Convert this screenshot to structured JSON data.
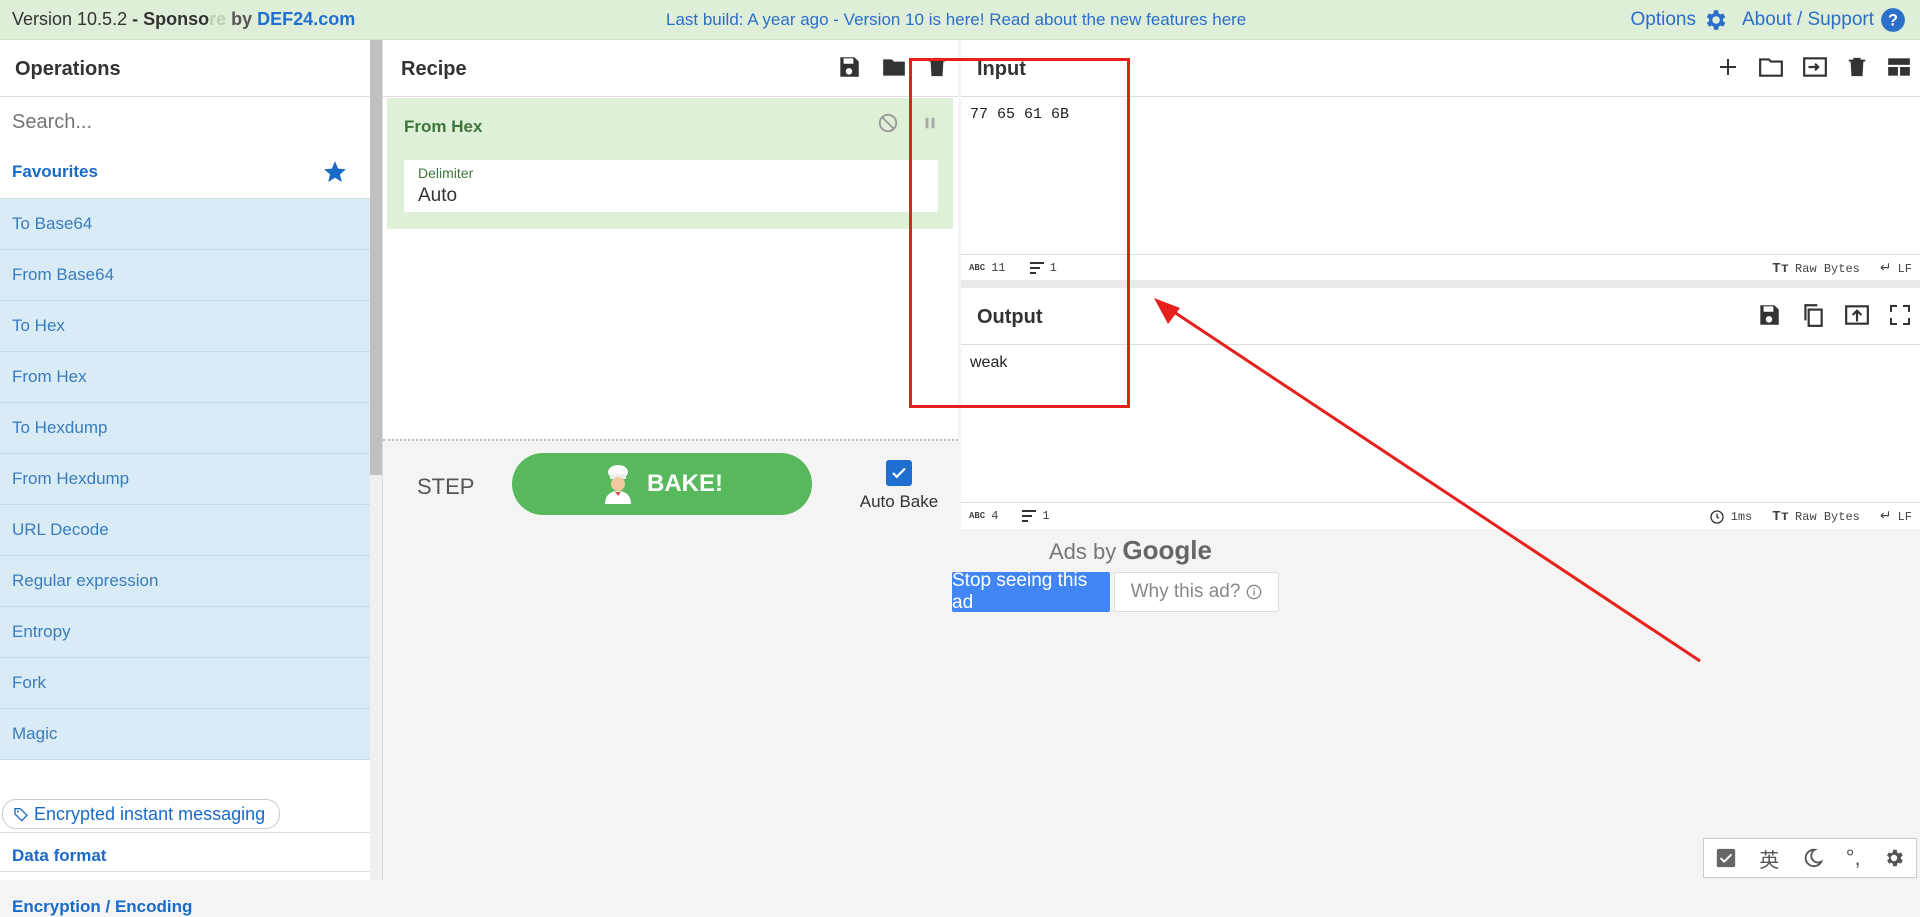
{
  "banner": {
    "version": "Version 10.5.2",
    "sponsor_prefix": "- Sponso",
    "sponsor_faded": "re",
    "sponsor_by": "by",
    "sponsor_brand": "DEF24.com",
    "build_notice": "Last build: A year ago - Version 10 is here! Read about the new features here",
    "options": "Options",
    "about": "About / Support"
  },
  "operations": {
    "title": "Operations",
    "search_placeholder": "Search...",
    "favourites": "Favourites",
    "items": [
      "To Base64",
      "From Base64",
      "To Hex",
      "From Hex",
      "To Hexdump",
      "From Hexdump",
      "URL Decode",
      "Regular expression",
      "Entropy",
      "Fork",
      "Magic"
    ],
    "tag": "Encrypted instant messaging",
    "categories": [
      "Data format",
      "Encryption / Encoding"
    ]
  },
  "recipe": {
    "title": "Recipe",
    "operation": {
      "name": "From Hex",
      "field_label": "Delimiter",
      "field_value": "Auto"
    },
    "step_label": "STEP",
    "bake_label": "BAKE!",
    "auto_bake_label": "Auto Bake",
    "auto_bake_checked": true
  },
  "input": {
    "title": "Input",
    "text": "77 65 61 6B",
    "chars": "11",
    "lines": "1",
    "encoding": "Raw Bytes",
    "eol": "LF"
  },
  "output": {
    "title": "Output",
    "text": "weak",
    "chars": "4",
    "lines": "1",
    "time": "1ms",
    "encoding": "Raw Bytes",
    "eol": "LF"
  },
  "ad": {
    "ads_by": "Ads by",
    "google": "Google",
    "stop": "Stop seeing this ad",
    "why": "Why this ad?"
  },
  "taskbar": {
    "ime": "英"
  },
  "colors": {
    "accent": "#1f6fd1",
    "bake_green": "#58b85c",
    "annotation_red": "#e8201c"
  }
}
